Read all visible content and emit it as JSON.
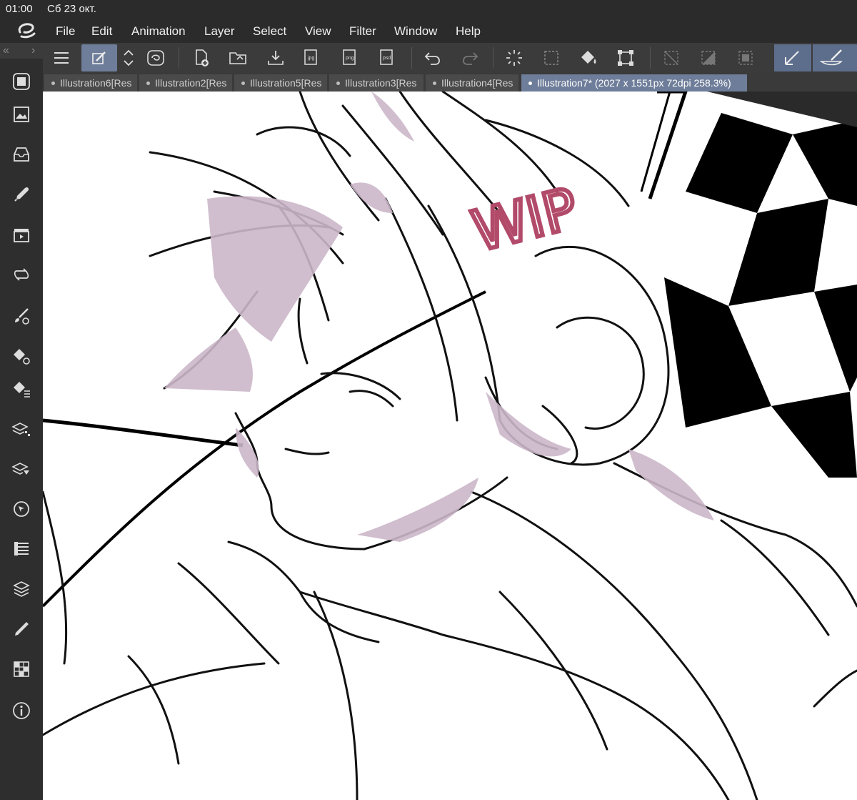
{
  "status_bar": {
    "time": "01:00",
    "date": "Сб 23 окт."
  },
  "menu": [
    "File",
    "Edit",
    "Animation",
    "Layer",
    "Select",
    "View",
    "Filter",
    "Window",
    "Help"
  ],
  "tabs": [
    {
      "label": "Illustration6[Res",
      "active": false
    },
    {
      "label": "Illustration2[Res",
      "active": false
    },
    {
      "label": "Illustration5[Res",
      "active": false
    },
    {
      "label": "Illustration3[Res",
      "active": false
    },
    {
      "label": "Illustration4[Res",
      "active": false
    },
    {
      "label": "Illustration7* (2027 x 1551px 72dpi 258.3%)",
      "active": true
    }
  ],
  "toolbar_icons": [
    "menu-icon",
    "pen-edit-icon",
    "up-down-arrows-icon",
    "spiral-icon",
    "new-file-icon",
    "open-folder-icon",
    "import-icon",
    "export-jpg-icon",
    "export-png-icon",
    "export-psd-icon",
    "undo-icon",
    "redo-icon",
    "spinner-icon",
    "selection-icon",
    "fill-bucket-icon",
    "transform-icon",
    "deselect-icon",
    "invert-selection-icon",
    "selection-border-icon",
    "correction-pen-icon",
    "brush-icon"
  ],
  "sidebar_icons": [
    "canvas-icon",
    "image-icon",
    "inbox-icon",
    "eyedropper-icon",
    "clapper-icon",
    "loop-icon",
    "brush-settings-icon",
    "fill-settings-icon",
    "fill-list-icon",
    "layer-properties-icon",
    "layer-search-icon",
    "navigator-icon",
    "list-icon",
    "layers-icon",
    "pencil-icon",
    "grid-icon",
    "info-icon"
  ],
  "canvas": {
    "watermark": "WIP",
    "accent_color": "#b24a6a",
    "shade_color": "#cbb7c9"
  },
  "colors": {
    "chrome": "#2b2b2b",
    "toolbar": "#3b3b3b",
    "active": "#6e7d99"
  }
}
